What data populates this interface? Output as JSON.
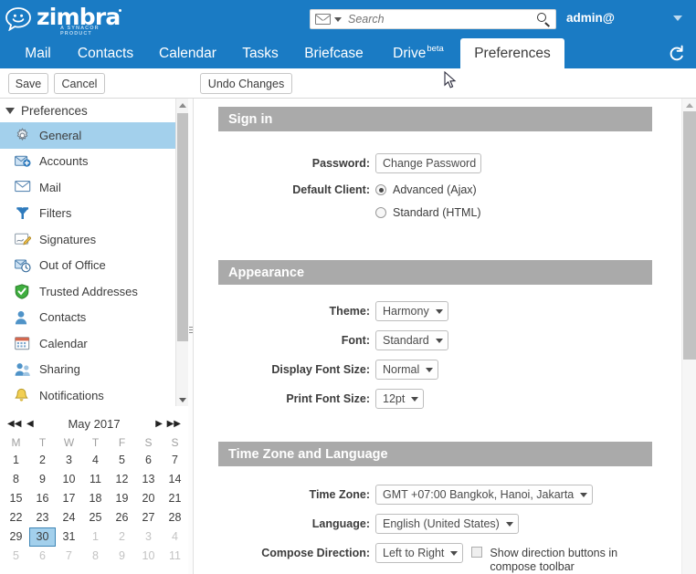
{
  "brand": {
    "name": "zimbra",
    "tagline": "A SYNACOR PRODUCT",
    "logo_icon": "smiley-speech-bubble-icon",
    "header_color": "#1a7bc4"
  },
  "search": {
    "placeholder": "Search",
    "value": "",
    "type_icon": "mail-icon",
    "submit_icon": "search-icon"
  },
  "account": {
    "label": "admin@",
    "menu_icon": "chevron-down-icon"
  },
  "tabs": [
    {
      "label": "Mail",
      "active": false
    },
    {
      "label": "Contacts",
      "active": false
    },
    {
      "label": "Calendar",
      "active": false
    },
    {
      "label": "Tasks",
      "active": false
    },
    {
      "label": "Briefcase",
      "active": false
    },
    {
      "label": "Drive",
      "badge": "beta",
      "active": false
    },
    {
      "label": "Preferences",
      "active": true
    }
  ],
  "refresh": {
    "icon": "refresh-icon",
    "title": "Refresh"
  },
  "toolbar": {
    "save_label": "Save",
    "cancel_label": "Cancel",
    "undo_label": "Undo Changes"
  },
  "sidebar": {
    "header": "Preferences",
    "items": [
      {
        "label": "General",
        "icon": "gear-icon",
        "selected": true
      },
      {
        "label": "Accounts",
        "icon": "accounts-icon",
        "selected": false
      },
      {
        "label": "Mail",
        "icon": "mail-icon",
        "selected": false
      },
      {
        "label": "Filters",
        "icon": "filter-funnel-icon",
        "selected": false
      },
      {
        "label": "Signatures",
        "icon": "signature-pencil-icon",
        "selected": false
      },
      {
        "label": "Out of Office",
        "icon": "out-of-office-icon",
        "selected": false
      },
      {
        "label": "Trusted Addresses",
        "icon": "shield-check-icon",
        "selected": false
      },
      {
        "label": "Contacts",
        "icon": "person-icon",
        "selected": false
      },
      {
        "label": "Calendar",
        "icon": "calendar-icon",
        "selected": false
      },
      {
        "label": "Sharing",
        "icon": "share-people-icon",
        "selected": false
      },
      {
        "label": "Notifications",
        "icon": "bell-icon",
        "selected": false
      }
    ]
  },
  "mini_calendar": {
    "title": "May 2017",
    "nav": {
      "first": "◀◀",
      "prev": "◀",
      "next": "▶",
      "last": "▶▶"
    },
    "day_names": [
      "M",
      "T",
      "W",
      "T",
      "F",
      "S",
      "S"
    ],
    "today": 30,
    "weeks": [
      [
        {
          "d": 1
        },
        {
          "d": 2
        },
        {
          "d": 3
        },
        {
          "d": 4
        },
        {
          "d": 5
        },
        {
          "d": 6
        },
        {
          "d": 7
        }
      ],
      [
        {
          "d": 8
        },
        {
          "d": 9
        },
        {
          "d": 10
        },
        {
          "d": 11
        },
        {
          "d": 12
        },
        {
          "d": 13
        },
        {
          "d": 14
        }
      ],
      [
        {
          "d": 15
        },
        {
          "d": 16
        },
        {
          "d": 17
        },
        {
          "d": 18
        },
        {
          "d": 19
        },
        {
          "d": 20
        },
        {
          "d": 21
        }
      ],
      [
        {
          "d": 22
        },
        {
          "d": 23
        },
        {
          "d": 24
        },
        {
          "d": 25
        },
        {
          "d": 26
        },
        {
          "d": 27
        },
        {
          "d": 28
        }
      ],
      [
        {
          "d": 29
        },
        {
          "d": 30,
          "today": true
        },
        {
          "d": 31
        },
        {
          "d": 1,
          "other": true
        },
        {
          "d": 2,
          "other": true
        },
        {
          "d": 3,
          "other": true
        },
        {
          "d": 4,
          "other": true
        }
      ],
      [
        {
          "d": 5,
          "other": true
        },
        {
          "d": 6,
          "other": true
        },
        {
          "d": 7,
          "other": true
        },
        {
          "d": 8,
          "other": true
        },
        {
          "d": 9,
          "other": true
        },
        {
          "d": 10,
          "other": true
        },
        {
          "d": 11,
          "other": true
        }
      ]
    ]
  },
  "sections": {
    "signin": {
      "title": "Sign in",
      "password_label": "Password:",
      "change_password_label": "Change Password",
      "default_client_label": "Default Client:",
      "client_options": [
        {
          "label": "Advanced (Ajax)",
          "selected": true
        },
        {
          "label": "Standard (HTML)",
          "selected": false
        }
      ]
    },
    "appearance": {
      "title": "Appearance",
      "fields": [
        {
          "label": "Theme:",
          "value": "Harmony"
        },
        {
          "label": "Font:",
          "value": "Standard"
        },
        {
          "label": "Display Font Size:",
          "value": "Normal"
        },
        {
          "label": "Print Font Size:",
          "value": "12pt"
        }
      ]
    },
    "timezone": {
      "title": "Time Zone and Language",
      "timezone_label": "Time Zone:",
      "timezone_value": "GMT +07:00 Bangkok, Hanoi, Jakarta",
      "language_label": "Language:",
      "language_value": "English (United States)",
      "compose_direction_label": "Compose Direction:",
      "compose_direction_value": "Left to Right",
      "show_direction_checked": false,
      "show_direction_line1": "Show direction buttons in",
      "show_direction_line2": "compose toolbar"
    }
  }
}
